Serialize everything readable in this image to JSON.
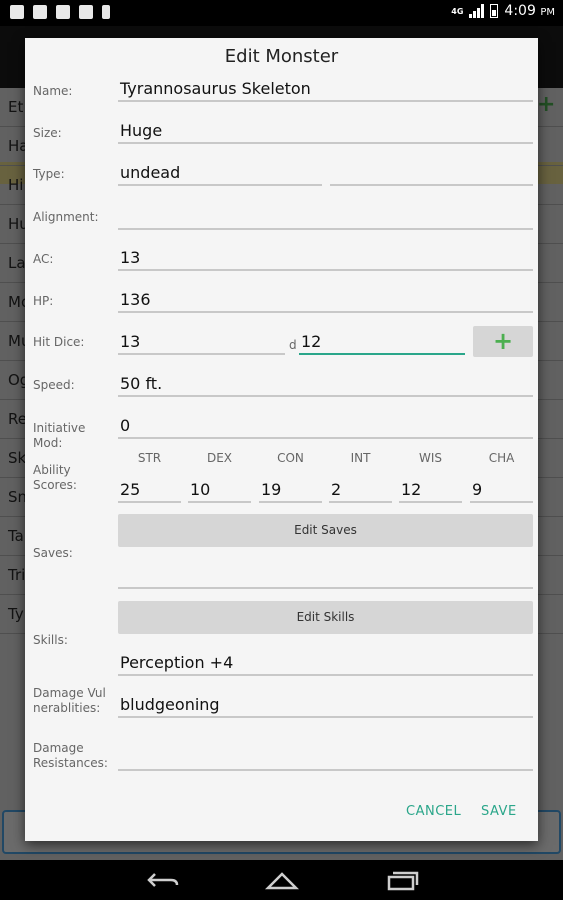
{
  "status_bar": {
    "network": "4G",
    "time": "4:09",
    "ampm": "PM"
  },
  "background_list": {
    "rows": [
      "Et",
      "Ha",
      "Hi",
      "Hu",
      "La",
      "Mo",
      "Mu",
      "Og",
      "Re",
      "Sk",
      "Sn",
      "Ta",
      "Tri",
      "Ty"
    ]
  },
  "dialog": {
    "title": "Edit Monster",
    "labels": {
      "name": "Name:",
      "size": "Size:",
      "type": "Type:",
      "alignment": "Alignment:",
      "ac": "AC:",
      "hp": "HP:",
      "hit_dice": "Hit Dice:",
      "speed": "Speed:",
      "initiative": "Initiative Mod:",
      "ability_scores": "Ability Scores:",
      "saves": "Saves:",
      "skills": "Skills:",
      "damage_vulnerabilities": "Damage Vulnerablities:",
      "damage_resistances": "Damage Resistances:"
    },
    "values": {
      "name": "Tyrannosaurus Skeleton",
      "size": "Huge",
      "type": "undead",
      "type_subtype": "",
      "alignment": "",
      "ac": "13",
      "hp": "136",
      "hit_dice_count": "13",
      "hit_dice_d": "d",
      "hit_dice_sides": "12",
      "speed": "50 ft.",
      "initiative": "0",
      "saves": "",
      "skills": "Perception +4",
      "damage_vulnerabilities": "bludgeoning",
      "damage_resistances": ""
    },
    "abilities": {
      "headers": [
        "STR",
        "DEX",
        "CON",
        "INT",
        "WIS",
        "CHA"
      ],
      "values": [
        "25",
        "10",
        "19",
        "2",
        "12",
        "9"
      ]
    },
    "buttons": {
      "add": "+",
      "edit_saves": "Edit Saves",
      "edit_skills": "Edit Skills",
      "cancel": "CANCEL",
      "save": "SAVE"
    }
  }
}
